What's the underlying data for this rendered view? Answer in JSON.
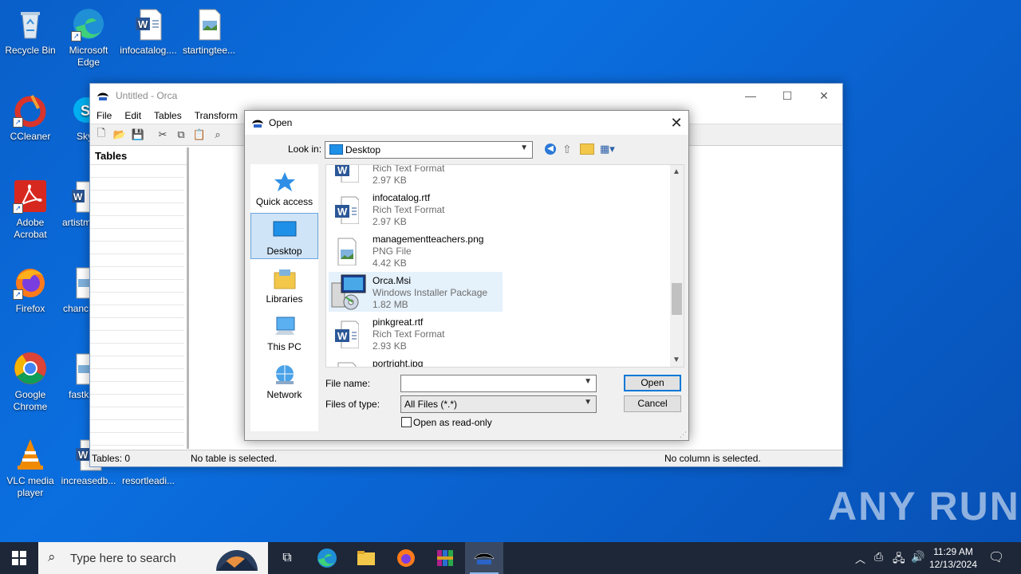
{
  "desktop": {
    "icons": [
      {
        "label": "Recycle Bin"
      },
      {
        "label": "Microsoft Edge"
      },
      {
        "label": "infocatalog...."
      },
      {
        "label": "startingtee..."
      },
      {
        "label": "CCleaner"
      },
      {
        "label": "Sky"
      },
      {
        "label": "Adobe Acrobat"
      },
      {
        "label": "artistm"
      },
      {
        "label": "Firefox"
      },
      {
        "label": "chanc"
      },
      {
        "label": "Google Chrome"
      },
      {
        "label": "fastk"
      },
      {
        "label": "VLC media player"
      },
      {
        "label": "increasedb..."
      },
      {
        "label": "resortleadi..."
      }
    ]
  },
  "orca": {
    "title": "Untitled - Orca",
    "menu": [
      "File",
      "Edit",
      "Tables",
      "Transform",
      "To"
    ],
    "tables_header": "Tables",
    "status": {
      "tables": "Tables: 0",
      "table_sel": "No table is selected.",
      "col_sel": "No column is selected."
    }
  },
  "dialog": {
    "title": "Open",
    "look_in_label": "Look in:",
    "look_in_value": "Desktop",
    "places": [
      "Quick access",
      "Desktop",
      "Libraries",
      "This PC",
      "Network"
    ],
    "files": [
      {
        "name": "",
        "type": "Rich Text Format",
        "size": "2.97 KB"
      },
      {
        "name": "infocatalog.rtf",
        "type": "Rich Text Format",
        "size": "2.97 KB"
      },
      {
        "name": "managementteachers.png",
        "type": "PNG File",
        "size": "4.42 KB"
      },
      {
        "name": "Orca.Msi",
        "type": "Windows Installer Package",
        "size": "1.82 MB"
      },
      {
        "name": "pinkgreat.rtf",
        "type": "Rich Text Format",
        "size": "2.93 KB"
      },
      {
        "name": "portright.jpg",
        "type": "",
        "size": ""
      }
    ],
    "file_name_label": "File name:",
    "file_name_value": "",
    "files_of_type_label": "Files of type:",
    "files_of_type_value": "All Files (*.*)",
    "readonly_label": "Open as read-only",
    "open_button": "Open",
    "cancel_button": "Cancel"
  },
  "taskbar": {
    "search_placeholder": "Type here to search",
    "time": "11:29 AM",
    "date": "12/13/2024"
  },
  "watermark": "ANY RUN"
}
